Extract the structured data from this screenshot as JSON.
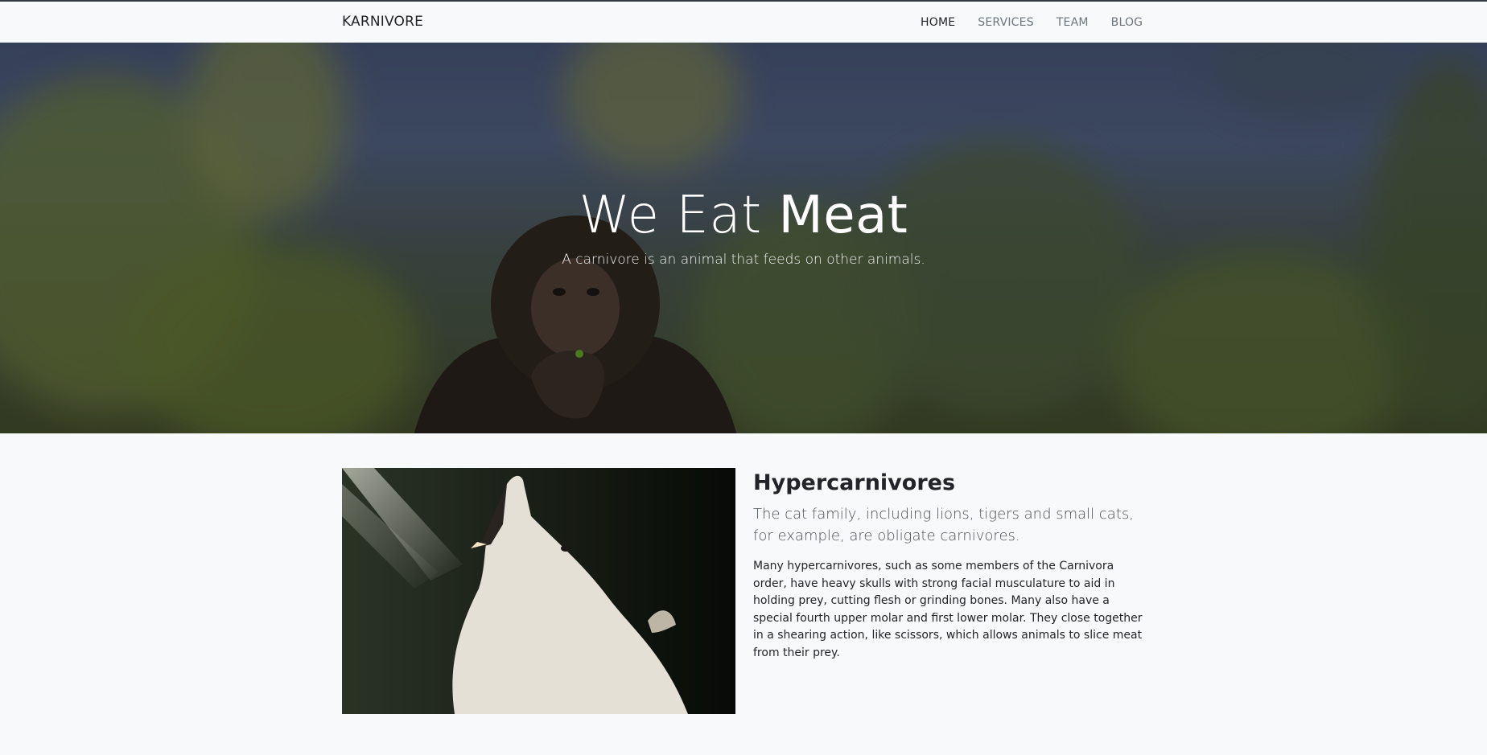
{
  "navbar": {
    "brand": "KARNIVORE",
    "items": [
      {
        "label": "HOME",
        "active": true
      },
      {
        "label": "SERVICES",
        "active": false
      },
      {
        "label": "TEAM",
        "active": false
      },
      {
        "label": "BLOG",
        "active": false
      }
    ]
  },
  "hero": {
    "title_light": "We Eat",
    "title_bold": "Meat",
    "subtitle": "A carnivore is an animal that feeds on other animals."
  },
  "feature": {
    "heading": "Hypercarnivores",
    "lead": "The cat family, including lions, tigers and small cats, for example, are obligate carnivores.",
    "body": "Many hypercarnivores, such as some members of the Carnivora order, have heavy skulls with strong facial musculature to aid in holding prey, cutting flesh or grinding bones. Many also have a special fourth upper molar and first lower molar. They close together in a shearing action, like scissors, which allows animals to slice meat from their prey."
  },
  "colors": {
    "navbar_bg": "#f8f9fa",
    "text": "#212529",
    "muted": "#6c757d"
  }
}
